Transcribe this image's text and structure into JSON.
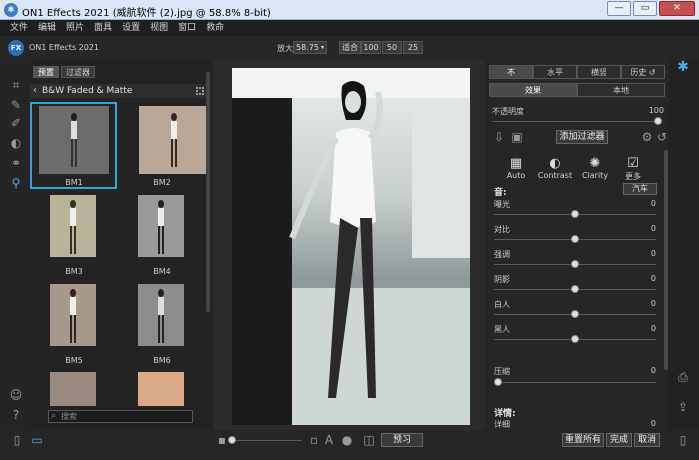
{
  "window": {
    "title": "ON1 Effects 2021 (威航软件 (2).jpg @ 58.8% 8-bit)",
    "minimize": "—",
    "maximize": "▭",
    "close": "✕"
  },
  "menu": [
    "文件",
    "编辑",
    "照片",
    "面具",
    "设置",
    "视图",
    "窗口",
    "救命"
  ],
  "toolbar": {
    "app_name": "ON1 Effects 2021",
    "logo": "FX",
    "zoom_label": "放大",
    "zoom_value": "58.75",
    "zoom_fit": "适合",
    "zoom_100": "100",
    "zoom_50": "50",
    "zoom_25": "25"
  },
  "browser": {
    "tab_presets": "预置",
    "tab_filters": "过滤器",
    "category": "B&W Faded & Matte",
    "thumbnails": [
      "BM1",
      "BM2",
      "BM3",
      "BM4",
      "BM5",
      "BM6",
      "",
      ""
    ],
    "search_placeholder": "搜索"
  },
  "right": {
    "view_tabs": [
      "不",
      "水平",
      "横竖",
      "历史"
    ],
    "panel_tabs": [
      "效果",
      "本地"
    ],
    "opacity_label": "不透明度",
    "opacity_value": "100",
    "opacity_level": 100,
    "add_filter": "添加过滤器",
    "modes": [
      "Auto",
      "Contrast",
      "Clarity",
      "更多"
    ],
    "tone_header": "音:",
    "auto_btn": "汽车",
    "sliders": [
      {
        "label": "曝光",
        "value": "0"
      },
      {
        "label": "对比",
        "value": "0"
      },
      {
        "label": "强调",
        "value": "0"
      },
      {
        "label": "阴影",
        "value": "0"
      },
      {
        "label": "白人",
        "value": "0"
      },
      {
        "label": "黑人",
        "value": "0"
      }
    ],
    "compress_label": "压缩",
    "compress_value": "0",
    "detail_header": "详情:",
    "detail_label": "详细",
    "detail_value": "0"
  },
  "bottom": {
    "preview": "预习",
    "reset_all": "重置所有",
    "done": "完成",
    "cancel": "取消"
  }
}
